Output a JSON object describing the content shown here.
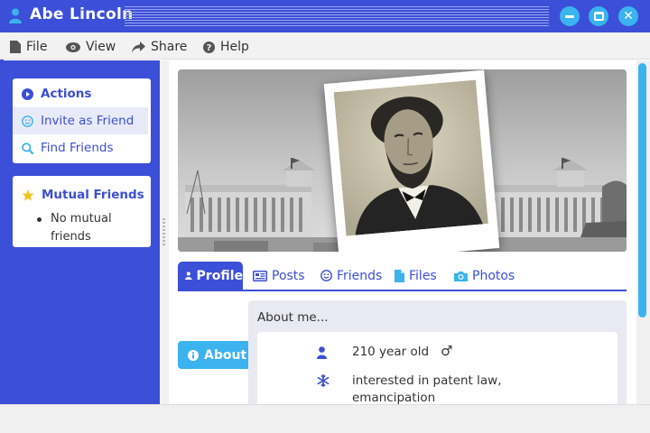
{
  "window": {
    "title": "Abe Lincoln"
  },
  "menu": {
    "file": "File",
    "view": "View",
    "share": "Share",
    "help": "Help"
  },
  "sidebar": {
    "actions_heading": "Actions",
    "invite_label": "Invite as Friend",
    "find_label": "Find Friends",
    "mutual_heading": "Mutual Friends",
    "mutual_empty": "No mutual friends"
  },
  "tabs": {
    "profile": "Profile",
    "posts": "Posts",
    "friends": "Friends",
    "files": "Files",
    "photos": "Photos"
  },
  "profile": {
    "about_tab": "About",
    "about_title": "About me...",
    "age_text": "210 year old",
    "gender_symbol": "♂",
    "interests_text": "interested in patent law, emancipation"
  },
  "colors": {
    "primary": "#3c4fd8",
    "accent": "#3ab3ee",
    "panel": "#e8e9f1"
  }
}
